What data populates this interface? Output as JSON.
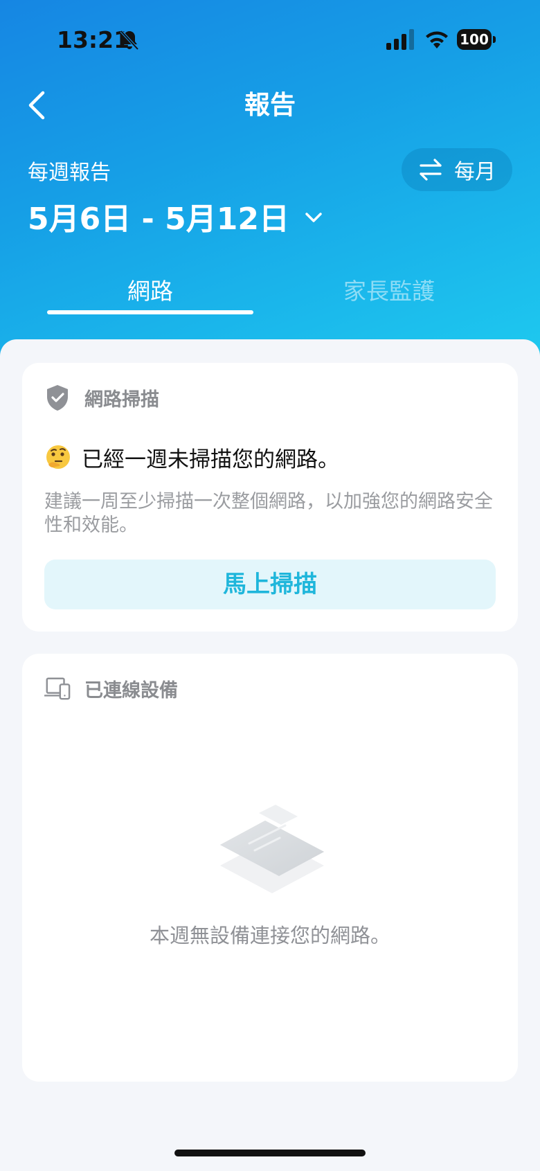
{
  "status_bar": {
    "time": "13:21",
    "battery": "100"
  },
  "nav": {
    "title": "報告"
  },
  "period": {
    "label": "每週報告",
    "range": "5月6日 - 5月12日",
    "toggle_label": "每月"
  },
  "tabs": [
    {
      "label": "網路",
      "active": true
    },
    {
      "label": "家長監護",
      "active": false
    }
  ],
  "scan_card": {
    "title": "網路掃描",
    "message": "已經一週未掃描您的網路。",
    "description": "建議一周至少掃描一次整個網路，以加強您的網路安全性和效能。",
    "button_label": "馬上掃描"
  },
  "devices_card": {
    "title": "已連線設備",
    "empty_text": "本週無設備連接您的網路。"
  },
  "icons": {
    "back": "chevron-left-icon",
    "bell": "bell-slash-icon",
    "signal": "cellular-signal-icon",
    "wifi": "wifi-icon",
    "swap": "swap-arrows-icon",
    "dropdown": "chevron-down-icon",
    "shield": "shield-check-icon",
    "devices": "devices-icon",
    "emoji": "thinking-face-emoji"
  },
  "colors": {
    "accent": "#1fb6db",
    "header_start": "#1686e3",
    "header_end": "#1ec9ef",
    "background": "#f4f6fa"
  }
}
